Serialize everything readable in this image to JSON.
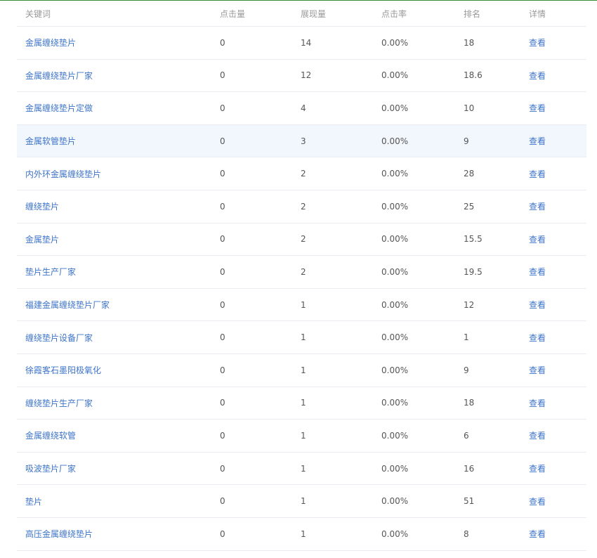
{
  "table": {
    "headers": {
      "keyword": "关键词",
      "clicks": "点击量",
      "impressions": "展现量",
      "ctr": "点击率",
      "rank": "排名",
      "detail": "详情"
    },
    "rows": [
      {
        "keyword": "金属缠绕垫片",
        "clicks": "0",
        "impressions": "14",
        "ctr": "0.00%",
        "rank": "18",
        "detail": "查看"
      },
      {
        "keyword": "金属缠绕垫片厂家",
        "clicks": "0",
        "impressions": "12",
        "ctr": "0.00%",
        "rank": "18.6",
        "detail": "查看"
      },
      {
        "keyword": "金属缠绕垫片定做",
        "clicks": "0",
        "impressions": "4",
        "ctr": "0.00%",
        "rank": "10",
        "detail": "查看"
      },
      {
        "keyword": "金属软管垫片",
        "clicks": "0",
        "impressions": "3",
        "ctr": "0.00%",
        "rank": "9",
        "detail": "查看"
      },
      {
        "keyword": "内外环金属缠绕垫片",
        "clicks": "0",
        "impressions": "2",
        "ctr": "0.00%",
        "rank": "28",
        "detail": "查看"
      },
      {
        "keyword": "缠绕垫片",
        "clicks": "0",
        "impressions": "2",
        "ctr": "0.00%",
        "rank": "25",
        "detail": "查看"
      },
      {
        "keyword": "金属垫片",
        "clicks": "0",
        "impressions": "2",
        "ctr": "0.00%",
        "rank": "15.5",
        "detail": "查看"
      },
      {
        "keyword": "垫片生产厂家",
        "clicks": "0",
        "impressions": "2",
        "ctr": "0.00%",
        "rank": "19.5",
        "detail": "查看"
      },
      {
        "keyword": "福建金属缠绕垫片厂家",
        "clicks": "0",
        "impressions": "1",
        "ctr": "0.00%",
        "rank": "12",
        "detail": "查看"
      },
      {
        "keyword": "缠绕垫片设备厂家",
        "clicks": "0",
        "impressions": "1",
        "ctr": "0.00%",
        "rank": "1",
        "detail": "查看"
      },
      {
        "keyword": "徐霞客石墨阳极氧化",
        "clicks": "0",
        "impressions": "1",
        "ctr": "0.00%",
        "rank": "9",
        "detail": "查看"
      },
      {
        "keyword": "缠绕垫片生产厂家",
        "clicks": "0",
        "impressions": "1",
        "ctr": "0.00%",
        "rank": "18",
        "detail": "查看"
      },
      {
        "keyword": "金属缠绕软管",
        "clicks": "0",
        "impressions": "1",
        "ctr": "0.00%",
        "rank": "6",
        "detail": "查看"
      },
      {
        "keyword": "吸波垫片厂家",
        "clicks": "0",
        "impressions": "1",
        "ctr": "0.00%",
        "rank": "16",
        "detail": "查看"
      },
      {
        "keyword": "垫片",
        "clicks": "0",
        "impressions": "1",
        "ctr": "0.00%",
        "rank": "51",
        "detail": "查看"
      },
      {
        "keyword": "高压金属缠绕垫片",
        "clicks": "0",
        "impressions": "1",
        "ctr": "0.00%",
        "rank": "8",
        "detail": "查看"
      }
    ],
    "highlighted_row": 3
  },
  "colors": {
    "link": "#3d74c9",
    "header_text": "#999999",
    "body_text": "#555555",
    "row_highlight": "#f2f6fd",
    "row_border": "#eaeef2",
    "top_line": "#3a8a3a"
  }
}
